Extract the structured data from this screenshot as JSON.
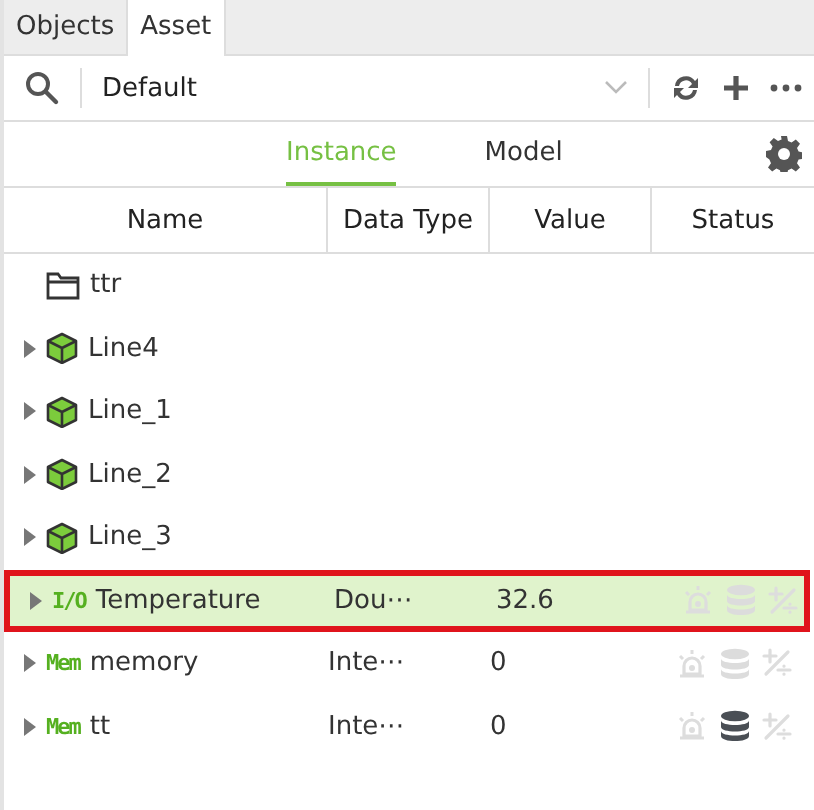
{
  "tabs": [
    {
      "label": "Objects",
      "selected": false
    },
    {
      "label": "Asset",
      "selected": true
    }
  ],
  "toolbar": {
    "filter": "Default"
  },
  "view_tabs": [
    {
      "label": "Instance",
      "selected": true
    },
    {
      "label": "Model",
      "selected": false
    }
  ],
  "table": {
    "columns": [
      "Name",
      "Data Type",
      "Value",
      "Status"
    ],
    "rows": [
      {
        "kind": "folder",
        "name": "ttr",
        "expandable": false,
        "selected": false
      },
      {
        "kind": "object",
        "name": "Line4",
        "expandable": true,
        "selected": false
      },
      {
        "kind": "object",
        "name": "Line_1",
        "expandable": true,
        "selected": false
      },
      {
        "kind": "object",
        "name": "Line_2",
        "expandable": true,
        "selected": false
      },
      {
        "kind": "object",
        "name": "Line_3",
        "expandable": true,
        "selected": false
      },
      {
        "kind": "tag",
        "badge": "I/O",
        "name": "Temperature",
        "data_type": "Dou⋯",
        "value": "32.6",
        "expandable": true,
        "selected": true,
        "logging": false
      },
      {
        "kind": "tag",
        "badge": "Mem",
        "name": "memory",
        "data_type": "Inte⋯",
        "value": "0",
        "expandable": true,
        "selected": false,
        "logging": false
      },
      {
        "kind": "tag",
        "badge": "Mem",
        "name": "tt",
        "data_type": "Inte⋯",
        "value": "0",
        "expandable": true,
        "selected": false,
        "logging": true
      }
    ]
  }
}
